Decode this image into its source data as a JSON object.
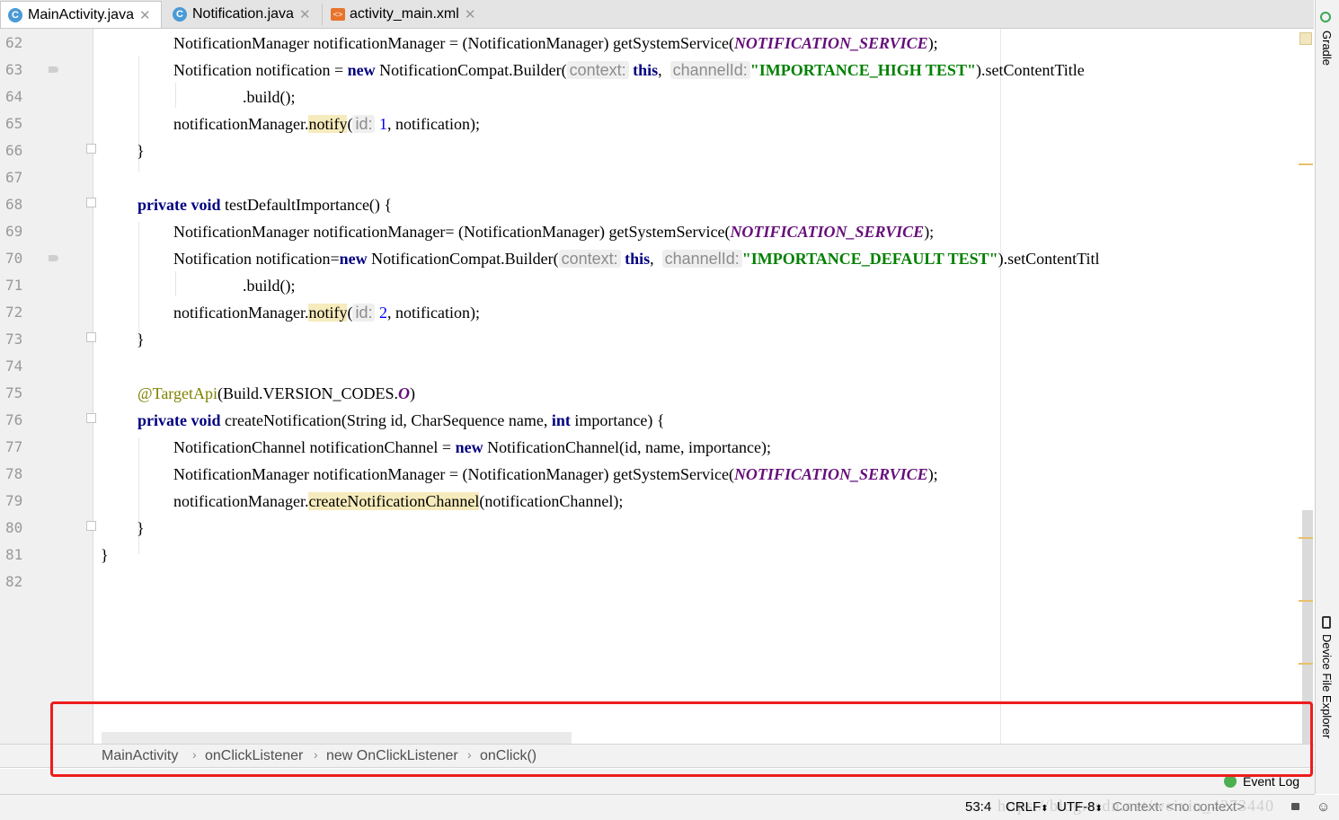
{
  "tabs": [
    {
      "label": "MainActivity.java",
      "icon": "class-icon",
      "active": true
    },
    {
      "label": "Notification.java",
      "icon": "class-icon",
      "active": false
    },
    {
      "label": "activity_main.xml",
      "icon": "xml-layout-icon",
      "active": false
    }
  ],
  "line_numbers": [
    "62",
    "63",
    "64",
    "65",
    "66",
    "67",
    "68",
    "69",
    "70",
    "71",
    "72",
    "73",
    "74",
    "75",
    "76",
    "77",
    "78",
    "79",
    "80",
    "81",
    "82"
  ],
  "code": {
    "l62": {
      "a": "NotificationManager notificationManager = (NotificationManager) getSystemService(",
      "b": "NOTIFICATION_SERVICE",
      "c": ");"
    },
    "l63": {
      "a": "Notification notification = ",
      "kw": "new",
      "b": " NotificationCompat.Builder(",
      "h1": "context:",
      "this": "this",
      "sep": ", ",
      "h2": "channelId:",
      "str": "\"IMPORTANCE_HIGH TEST\"",
      "c": ").setContentTitle"
    },
    "l64": {
      "a": ".build();"
    },
    "l65": {
      "a": "notificationManager.",
      "m": "notify",
      "p": "(",
      "h": "id:",
      "n": "1",
      "c": ", notification);"
    },
    "l66": {
      "a": "}"
    },
    "l68": {
      "k1": "private",
      "k2": "void",
      "a": " testDefaultImportance() {"
    },
    "l69": {
      "a": "NotificationManager notificationManager= (NotificationManager) getSystemService(",
      "b": "NOTIFICATION_SERVICE",
      "c": ");"
    },
    "l70": {
      "a": "Notification notification=",
      "kw": "new",
      "b": " NotificationCompat.Builder(",
      "h1": "context:",
      "this": "this",
      "sep": ", ",
      "h2": "channelId:",
      "str": "\"IMPORTANCE_DEFAULT TEST\"",
      "c": ").setContentTitl"
    },
    "l71": {
      "a": ".build();"
    },
    "l72": {
      "a": "notificationManager.",
      "m": "notify",
      "p": "(",
      "h": "id:",
      "n": "2",
      "c": ", notification);"
    },
    "l73": {
      "a": "}"
    },
    "l75": {
      "ann": "@TargetApi",
      "a": "(Build.VERSION_CODES.",
      "b": "O",
      "c": ")"
    },
    "l76": {
      "k1": "private",
      "k2": "void",
      "a": " createNotification(String id, CharSequence name, ",
      "k3": "int",
      "b": " importance) {"
    },
    "l77": {
      "a": "NotificationChannel notificationChannel = ",
      "kw": "new",
      "b": " NotificationChannel(id, name, importance);"
    },
    "l78": {
      "a": "NotificationManager notificationManager = (NotificationManager) getSystemService(",
      "b": "NOTIFICATION_SERVICE",
      "c": ");"
    },
    "l79": {
      "a": "notificationManager.",
      "m": "createNotificationChannel",
      "c": "(notificationChannel);"
    },
    "l80": {
      "a": "}"
    },
    "l81": {
      "a": "}"
    }
  },
  "breadcrumb": [
    "MainActivity",
    "onClickListener",
    "new OnClickListener",
    "onClick()"
  ],
  "right_tools": {
    "gradle": "Gradle",
    "device_explorer": "Device File Explorer"
  },
  "event_log": "Event Log",
  "status": {
    "position": "53:4",
    "line_sep": "CRLF",
    "encoding": "UTF-8",
    "context": "Context: <no context>",
    "watermark": "https://blog.csdn.net/weixin_4273440"
  },
  "colors": {
    "keyword": "#000080",
    "string": "#008000",
    "constant": "#660e7a",
    "annotation": "#808000",
    "highlight": "#f6ebbc",
    "callout": "#ee1c1c"
  }
}
